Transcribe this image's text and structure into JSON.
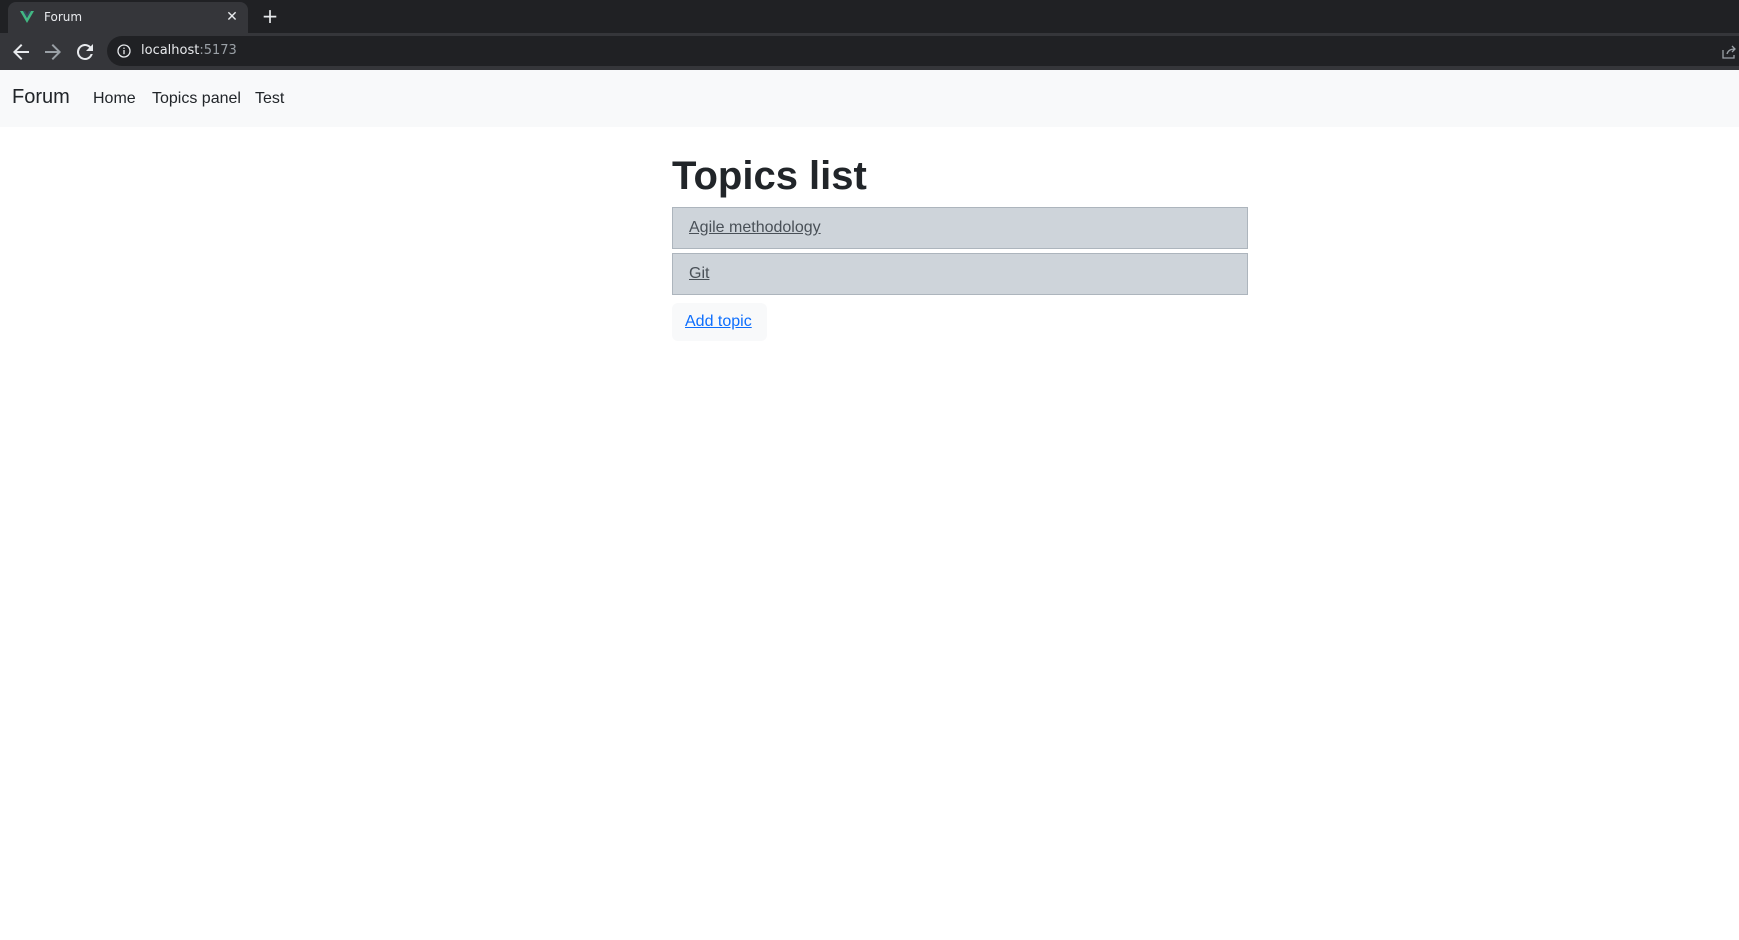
{
  "browser": {
    "tab": {
      "title": "Forum",
      "close_glyph": "✕",
      "favicon": "vue-logo-icon"
    },
    "new_tab_glyph": "+",
    "url": {
      "host": "localhost",
      "port": ":5173"
    },
    "accent_color": "#42b883"
  },
  "navbar": {
    "brand": "Forum",
    "links": [
      "Home",
      "Topics panel",
      "Test"
    ]
  },
  "main": {
    "title": "Topics list",
    "topics": [
      "Agile methodology",
      "Git"
    ],
    "add_topic_label": "Add topic"
  },
  "colors": {
    "topic_background": "#ced4da",
    "link_blue": "#0d6efd",
    "navbar_background": "#f8f9fa"
  }
}
